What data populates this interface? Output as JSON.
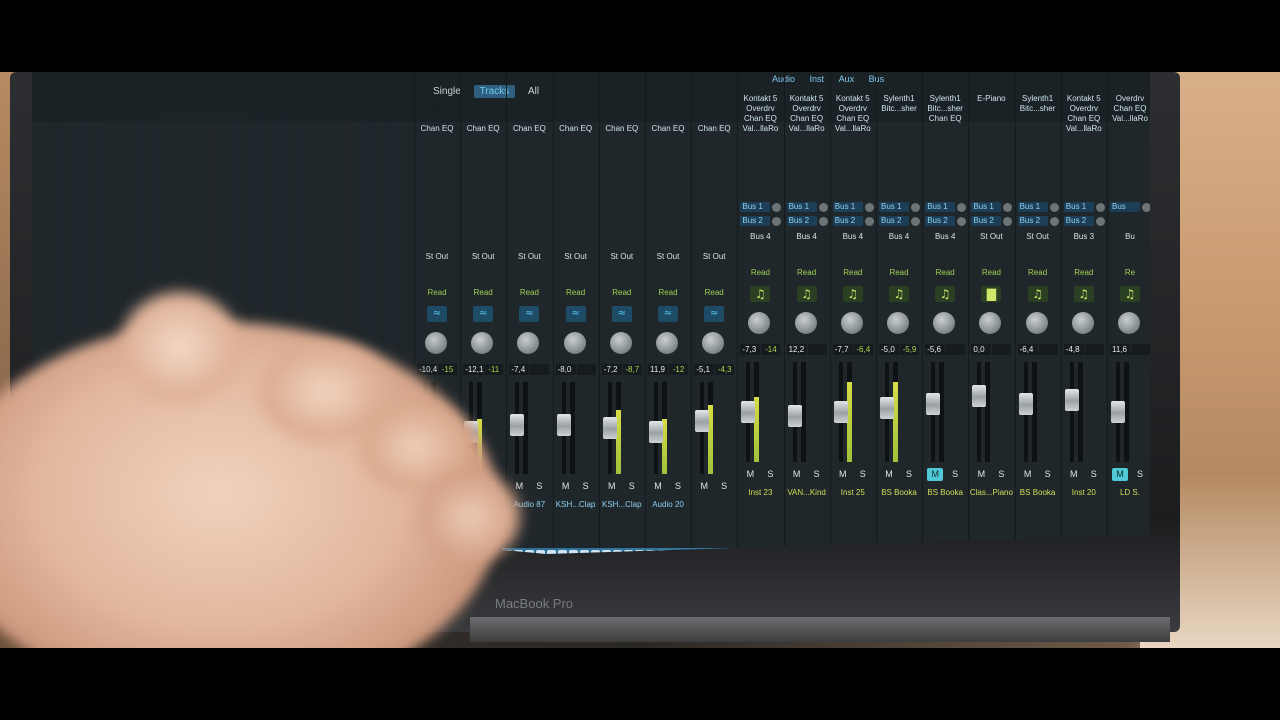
{
  "mixer": {
    "filter_tabs": [
      {
        "label": "Single",
        "selected": false
      },
      {
        "label": "Tracks",
        "selected": true
      },
      {
        "label": "All",
        "selected": false
      }
    ],
    "top_categories": [
      "Audio",
      "Inst",
      "Aux",
      "Bus"
    ],
    "channels": [
      {
        "plugins": [
          "Chan EQ"
        ],
        "output": "St Out",
        "read": "Read",
        "vol": "-10,4",
        "peak": "-15",
        "name": "",
        "type": "audio",
        "icon": "eq",
        "fader": 0.5,
        "meter": 0.25
      },
      {
        "plugins": [
          "Chan EQ"
        ],
        "output": "St Out",
        "read": "Read",
        "vol": "-12,1",
        "peak": "-11",
        "name": "",
        "type": "audio",
        "icon": "eq",
        "fader": 0.45,
        "meter": 0.6
      },
      {
        "plugins": [
          "Chan EQ"
        ],
        "output": "St Out",
        "read": "Read",
        "vol": "-7,4",
        "peak": "",
        "name": "Audio 87",
        "type": "audio",
        "icon": "eq",
        "fader": 0.55,
        "meter": 0.0
      },
      {
        "plugins": [
          "Chan EQ"
        ],
        "output": "St Out",
        "read": "Read",
        "vol": "-8,0",
        "peak": "",
        "name": "KSH...Clap",
        "type": "audio",
        "icon": "eq",
        "fader": 0.55,
        "meter": 0.0
      },
      {
        "plugins": [
          "Chan EQ"
        ],
        "output": "St Out",
        "read": "Read",
        "vol": "-7,2",
        "peak": "-8,7",
        "name": "KSH...Clap",
        "type": "audio",
        "icon": "eq",
        "fader": 0.5,
        "meter": 0.7
      },
      {
        "plugins": [
          "Chan EQ"
        ],
        "output": "St Out",
        "read": "Read",
        "vol": "11,9",
        "peak": "-12",
        "name": "Audio 20",
        "type": "audio",
        "icon": "eq",
        "fader": 0.45,
        "meter": 0.6
      },
      {
        "plugins": [
          "Chan EQ"
        ],
        "output": "St Out",
        "read": "Read",
        "vol": "-5,1",
        "peak": "-4,3",
        "name": "",
        "type": "audio",
        "icon": "eq",
        "fader": 0.6,
        "meter": 0.75
      },
      {
        "plugins": [
          "Kontakt 5",
          "Overdrv",
          "Chan EQ",
          "Val...llaRo"
        ],
        "buses": [
          "Bus 1",
          "Bus 2"
        ],
        "output": "Bus 4",
        "read": "Read",
        "vol": "-7,3",
        "peak": "-14",
        "name": "Inst 23",
        "type": "inst",
        "icon": "note",
        "fader": 0.5,
        "meter": 0.65
      },
      {
        "plugins": [
          "Kontakt 5",
          "Overdrv",
          "Chan EQ",
          "Val...llaRo"
        ],
        "buses": [
          "Bus 1",
          "Bus 2"
        ],
        "output": "Bus 4",
        "read": "Read",
        "vol": "12,2",
        "peak": "",
        "name": "VAN...Kind",
        "type": "inst",
        "icon": "note",
        "fader": 0.45,
        "meter": 0.0
      },
      {
        "plugins": [
          "Kontakt 5",
          "Overdrv",
          "Chan EQ",
          "Val...llaRo"
        ],
        "buses": [
          "Bus 1",
          "Bus 2"
        ],
        "output": "Bus 4",
        "read": "Read",
        "vol": "-7,7",
        "peak": "-6,4",
        "name": "Inst 25",
        "type": "inst",
        "icon": "note",
        "fader": 0.5,
        "meter": 0.8
      },
      {
        "plugins": [
          "Sylenth1",
          "Bitc...sher"
        ],
        "buses": [
          "Bus 1",
          "Bus 2"
        ],
        "output": "Bus 4",
        "read": "Read",
        "vol": "-5,0",
        "peak": "-5,9",
        "name": "BS Booka",
        "type": "inst",
        "icon": "note",
        "fader": 0.55,
        "meter": 0.8
      },
      {
        "plugins": [
          "Sylenth1",
          "Bitc...sher",
          "Chan EQ"
        ],
        "buses": [
          "Bus 1",
          "Bus 2"
        ],
        "output": "Bus 4",
        "read": "Read",
        "vol": "-5,6",
        "peak": "",
        "name": "BS Booka",
        "type": "inst",
        "icon": "note",
        "fader": 0.6,
        "meter": 0.0,
        "mute": true
      },
      {
        "plugins": [
          "E-Piano"
        ],
        "buses": [
          "Bus 1",
          "Bus 2"
        ],
        "output": "St Out",
        "read": "Read",
        "vol": "0,0",
        "peak": "",
        "name": "Clas...Piano",
        "type": "inst",
        "icon": "piano",
        "fader": 0.7,
        "meter": 0.0
      },
      {
        "plugins": [
          "Sylenth1",
          "Bitc...sher"
        ],
        "buses": [
          "Bus 1",
          "Bus 2"
        ],
        "output": "St Out",
        "read": "Read",
        "vol": "-6,4",
        "peak": "",
        "name": "BS Booka",
        "type": "inst",
        "icon": "note",
        "fader": 0.6,
        "meter": 0.0
      },
      {
        "plugins": [
          "Kontakt 5",
          "Overdrv",
          "Chan EQ",
          "Val...llaRo"
        ],
        "buses": [
          "Bus 1",
          "Bus 2"
        ],
        "output": "Bus 3",
        "read": "Read",
        "vol": "-4,8",
        "peak": "",
        "name": "Inst 20",
        "type": "inst",
        "icon": "note",
        "fader": 0.65,
        "meter": 0.0
      },
      {
        "plugins": [
          "Overdrv",
          "Chan EQ",
          "Val...llaRo"
        ],
        "buses": [
          "Bus"
        ],
        "output": "Bu",
        "read": "Re",
        "vol": "11,6",
        "peak": "",
        "name": "LD S.",
        "type": "inst",
        "icon": "note",
        "fader": 0.5,
        "meter": 0.0,
        "mute": true
      }
    ],
    "mute_label": "M",
    "solo_label": "S"
  },
  "laptop": {
    "brand": "MacBook Pro"
  },
  "colors": {
    "inst_name": "#d2dd54",
    "audio_name": "#8fd0f2",
    "plugin_slot": "#1f4a66",
    "mute_on": "#4fc9d6"
  }
}
